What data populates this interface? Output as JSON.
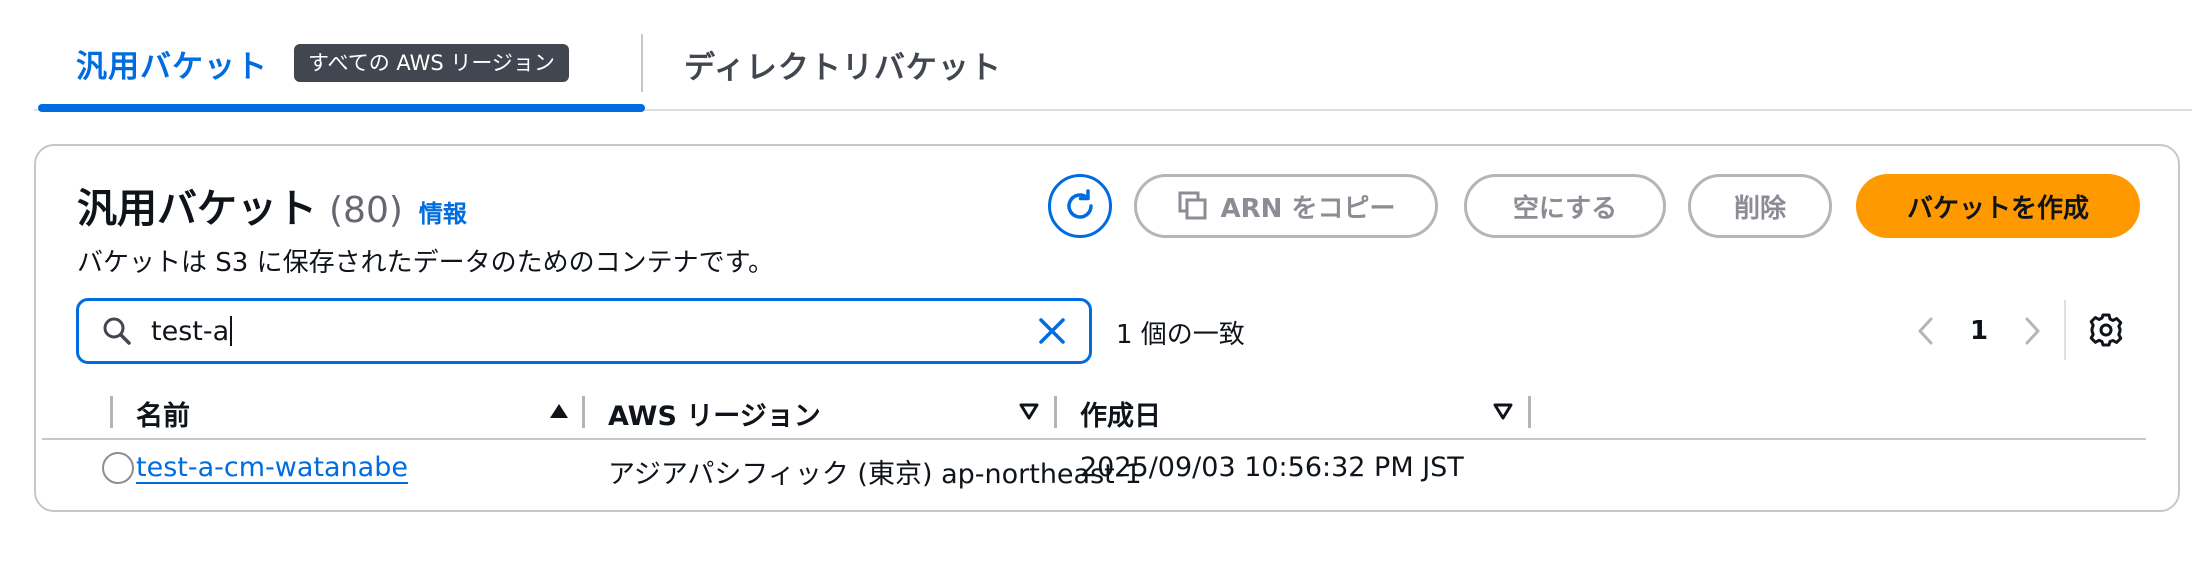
{
  "tabs": {
    "general_label": "汎用バケット",
    "region_badge": "すべての AWS リージョン",
    "directory_label": "ディレクトリバケット"
  },
  "panel": {
    "title": "汎用バケット",
    "count": "(80)",
    "info_link": "情報",
    "description": "バケットは S3 に保存されたデータのためのコンテナです。",
    "actions": {
      "copy_arn": "ARN をコピー",
      "empty": "空にする",
      "delete": "削除",
      "create": "バケットを作成"
    },
    "search": {
      "value": "test-a"
    },
    "match_text": "1 個の一致",
    "pagination": {
      "current_page": "1"
    }
  },
  "table": {
    "columns": [
      "名前",
      "AWS リージョン",
      "作成日"
    ],
    "rows": [
      {
        "name": "test-a-cm-watanabe",
        "region": "アジアパシフィック (東京) ap-northeast-1",
        "created": "2025/09/03 10:56:32 PM JST"
      }
    ]
  },
  "colors": {
    "accent": "#006ce0",
    "primary_button": "#ff9900",
    "badge_bg": "#424650",
    "disabled": "#8c8c94"
  },
  "icons": [
    "refresh-icon",
    "copy-icon",
    "search-icon",
    "clear-icon",
    "chevron-left-icon",
    "chevron-right-icon",
    "gear-icon",
    "sort-ascending-icon",
    "sort-descending-icon"
  ]
}
